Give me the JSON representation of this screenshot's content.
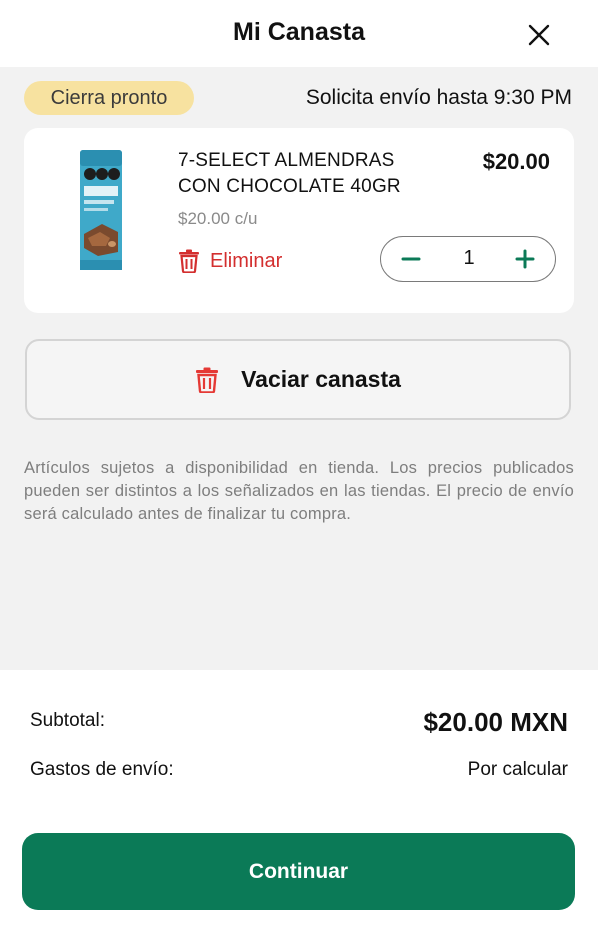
{
  "header": {
    "title": "Mi Canasta",
    "close_icon": "close-icon"
  },
  "status": {
    "badge": "Cierra pronto",
    "delivery_note": "Solicita envío hasta 9:30 PM"
  },
  "cart": {
    "items": [
      {
        "name_line1": "7-SELECT ALMENDRAS",
        "name_line2": "CON CHOCOLATE 40GR",
        "price": "$20.00",
        "unit_price": "$20.00 c/u",
        "remove_label": "Eliminar",
        "quantity": "1"
      }
    ],
    "empty_label": "Vaciar canasta"
  },
  "disclaimer": "Artículos sujetos a disponibilidad en tienda. Los precios publicados pueden ser distintos a los señalizados en las tiendas. El precio de envío será calculado antes de finalizar tu compra.",
  "summary": {
    "subtotal_label": "Subtotal:",
    "subtotal_value": "$20.00 MXN",
    "shipping_label": "Gastos de envío:",
    "shipping_value": "Por calcular"
  },
  "actions": {
    "continue_label": "Continuar"
  },
  "colors": {
    "primary": "#0b7a57",
    "danger": "#d32f2f",
    "badge_bg": "#f7e2a0",
    "surface": "#f2f2f2"
  }
}
